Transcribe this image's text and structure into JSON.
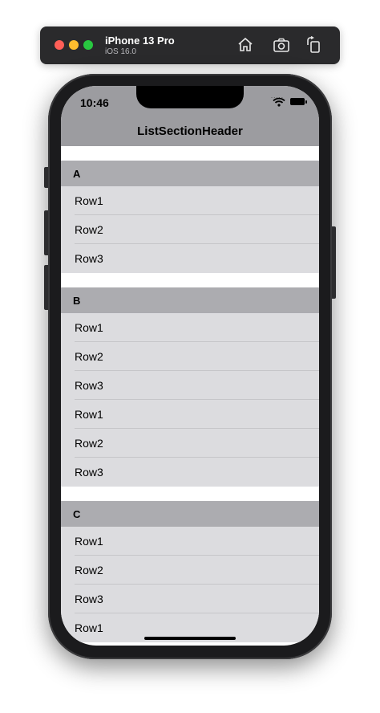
{
  "simulator": {
    "device_name": "iPhone 13 Pro",
    "os_version": "iOS 16.0",
    "toolbar_icons": [
      "home-icon",
      "screenshot-icon",
      "rotate-icon"
    ]
  },
  "status_bar": {
    "time": "10:46",
    "signal": ".....",
    "icons": [
      "wifi-icon",
      "battery-icon"
    ]
  },
  "nav": {
    "title": "ListSectionHeader"
  },
  "sections": [
    {
      "header": "A",
      "rows": [
        "Row1",
        "Row2",
        "Row3"
      ]
    },
    {
      "header": "B",
      "rows": [
        "Row1",
        "Row2",
        "Row3",
        "Row1",
        "Row2",
        "Row3"
      ]
    },
    {
      "header": "C",
      "rows": [
        "Row1",
        "Row2",
        "Row3",
        "Row1"
      ]
    }
  ],
  "colors": {
    "nav_background": "#9c9ca0",
    "section_header": "#acacb0",
    "row_background": "#dcdcdf"
  }
}
